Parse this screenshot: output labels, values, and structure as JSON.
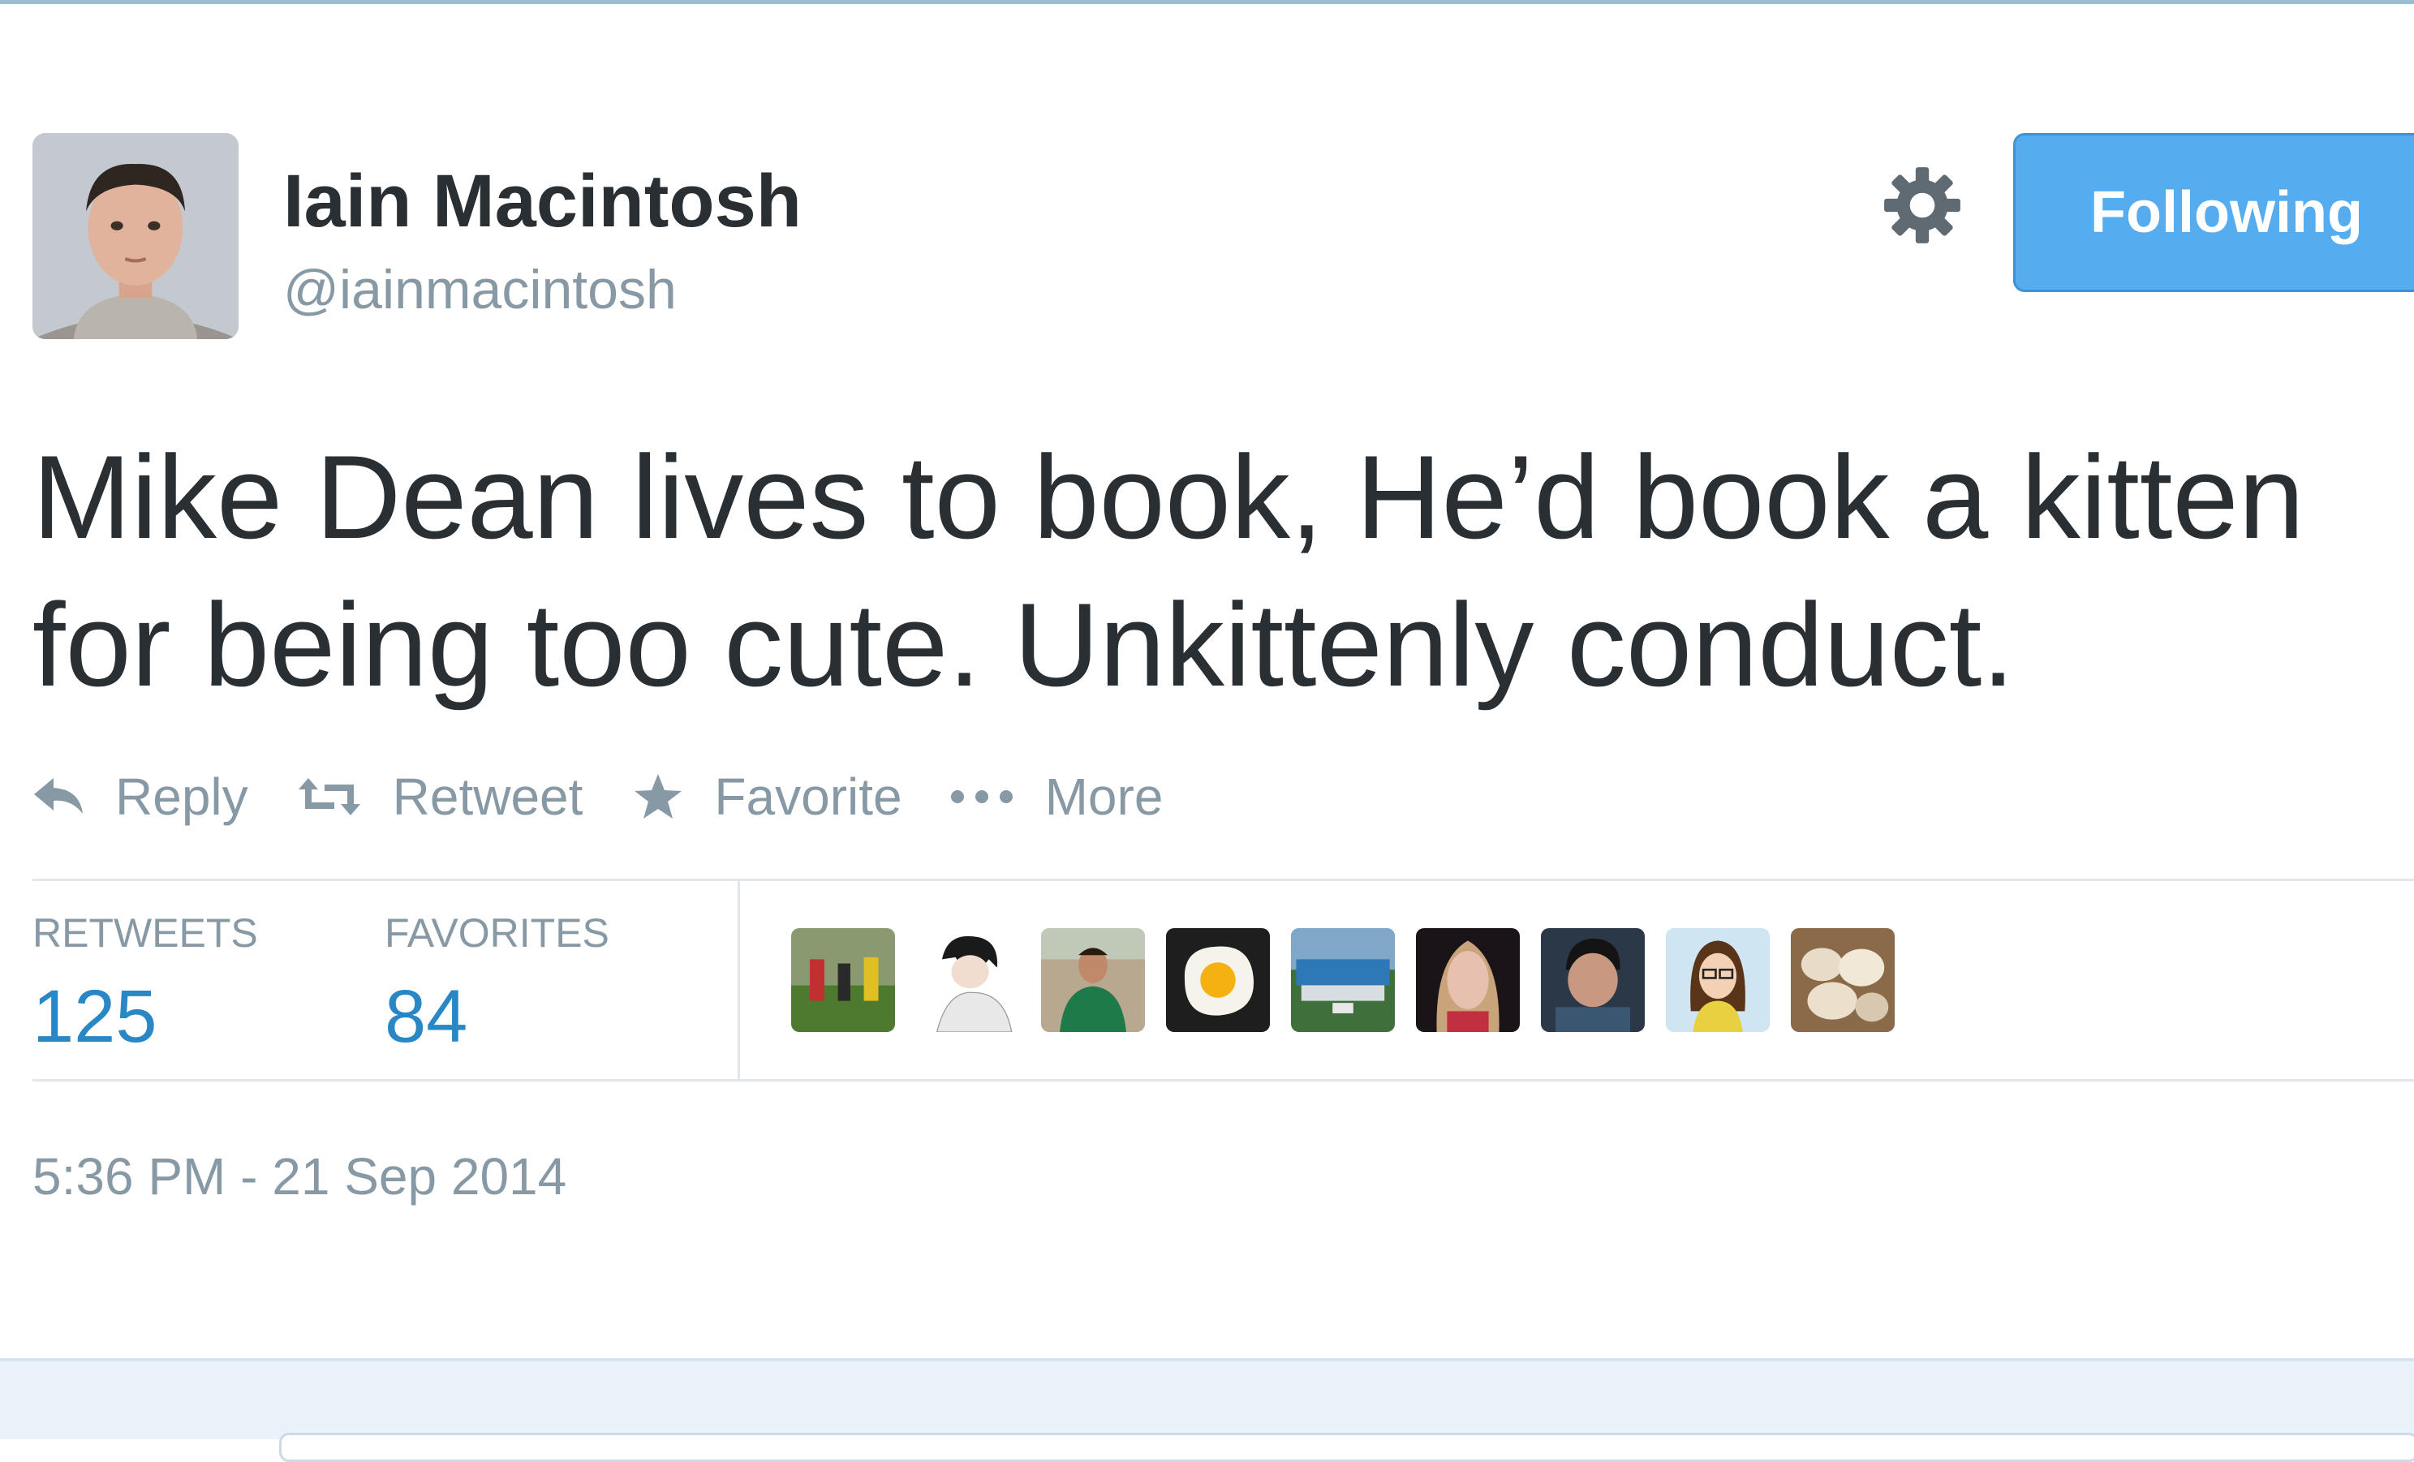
{
  "tweet": {
    "user": {
      "name": "Iain Macintosh",
      "handle": "@iainmacintosh"
    },
    "follow_button_label": "Following",
    "text": "Mike Dean lives to book, He’d book a kitten for being too cute. Unkittenly conduct.",
    "timestamp": "5:36 PM - 21 Sep 2014"
  },
  "actions": {
    "reply": "Reply",
    "retweet": "Retweet",
    "favorite": "Favorite",
    "more": "More"
  },
  "stats": {
    "retweets_label": "RETWEETS",
    "retweets_value": "125",
    "favorites_label": "FAVORITES",
    "favorites_value": "84"
  },
  "colors": {
    "accent": "#55acee",
    "stat_value": "#2a87c5",
    "muted_text": "#8899a6",
    "primary_text": "#292f33",
    "divider": "#e1e8ed"
  },
  "icons": [
    "gear-icon",
    "reply-icon",
    "retweet-icon",
    "star-icon",
    "more-dots-icon"
  ]
}
